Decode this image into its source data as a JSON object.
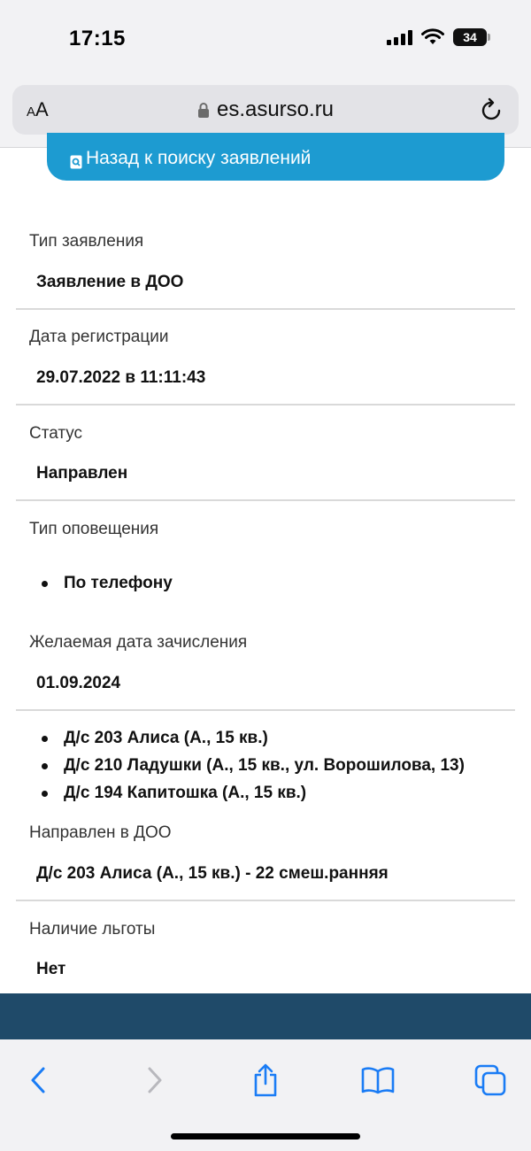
{
  "status_bar": {
    "time": "17:15",
    "battery": "34"
  },
  "address_bar": {
    "aa_label_small": "A",
    "aa_label_large": "A",
    "url": "es.asurso.ru"
  },
  "back_button": {
    "label": "Назад к поиску заявлений"
  },
  "fields": {
    "type": {
      "label": "Тип заявления",
      "value": "Заявление в ДОО"
    },
    "registration_date": {
      "label": "Дата регистрации",
      "value": "29.07.2022 в 11:11:43"
    },
    "status": {
      "label": "Статус",
      "value": "Направлен"
    },
    "notification": {
      "label": "Тип оповещения",
      "items": [
        "По телефону"
      ]
    },
    "desired_date": {
      "label": "Желаемая дата зачисления",
      "value": "01.09.2024"
    },
    "kindergartens": {
      "items": [
        "Д/с 203 Алиса (А., 15 кв.)",
        "Д/с 210 Ладушки (А., 15 кв., ул. Ворошилова, 13)",
        "Д/с 194 Капитошка (А., 15 кв.)"
      ]
    },
    "directed_to": {
      "label": "Направлен в ДОО",
      "value": "Д/с 203 Алиса (А., 15 кв.) - 22 смеш.ранняя"
    },
    "benefit": {
      "label": "Наличие льготы",
      "value": "Нет"
    }
  },
  "colors": {
    "accent": "#1d9bd1",
    "footer": "#1f4a69",
    "toolbar_icon": "#1a7cf5"
  },
  "toolbar": {
    "icons": [
      "back-icon",
      "forward-icon",
      "share-icon",
      "bookmarks-icon",
      "tabs-icon"
    ]
  }
}
